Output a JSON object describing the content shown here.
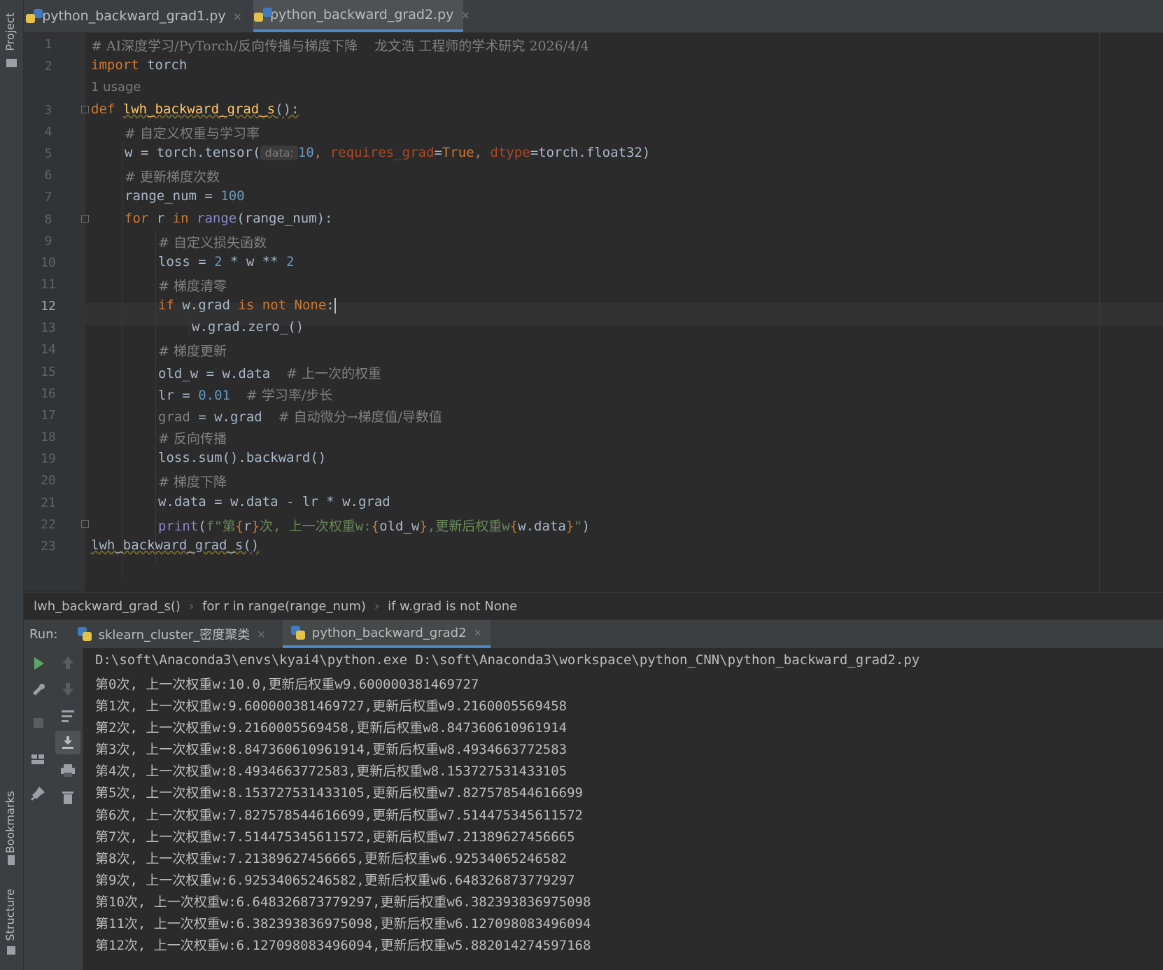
{
  "side_panel": {
    "project_label": "Project",
    "bookmarks_label": "Bookmarks",
    "structure_label": "Structure"
  },
  "tabs": [
    {
      "label": "python_backward_grad1.py",
      "close": "×"
    },
    {
      "label": "python_backward_grad2.py",
      "close": "×"
    }
  ],
  "editor": {
    "line_numbers": [
      "1",
      "2",
      "3",
      "4",
      "5",
      "6",
      "7",
      "8",
      "9",
      "10",
      "11",
      "12",
      "13",
      "14",
      "15",
      "16",
      "17",
      "18",
      "19",
      "20",
      "21",
      "22",
      "23"
    ],
    "current_line": "12",
    "usage_hint": "1 usage",
    "param_hint": "data:",
    "code": {
      "l1": "# AI深度学习/PyTorch/反向传播与梯度下降    龙文浩 工程师的学术研究 2026/4/4",
      "l2_kw": "import",
      "l2_rest": " torch",
      "l3_kw": "def",
      "l3_fn": "lwh_backward_grad_s",
      "l3_rest": "():",
      "l4": "# 自定义权重与学习率",
      "l5_a": "w = torch.tensor(",
      "l5_num": "10",
      "l5_comma1": ", ",
      "l5_p1": "requires_grad",
      "l5_eq1": "=",
      "l5_true": "True",
      "l5_comma2": ", ",
      "l5_p2": "dtype",
      "l5_tail": "=torch.float32)",
      "l6": "# 更新梯度次数",
      "l7_a": "range_num = ",
      "l7_num": "100",
      "l8_for": "for",
      "l8_b": " r ",
      "l8_in": "in",
      "l8_sp": " ",
      "l8_range": "range",
      "l8_tail": "(range_num):",
      "l9": "# 自定义损失函数",
      "l10_a": "loss = ",
      "l10_n1": "2",
      "l10_b": " * w ** ",
      "l10_n2": "2",
      "l11": "# 梯度清零",
      "l12_if": "if",
      "l12_b": " w.grad ",
      "l12_is": "is",
      "l12_sp": " ",
      "l12_not": "not",
      "l12_sp2": " ",
      "l12_none": "None",
      "l12_colon": ":",
      "l13": "w.grad.zero_()",
      "l14": "# 梯度更新",
      "l15_a": "old_w = w.data  ",
      "l15_c": "# 上一次的权重",
      "l16_a": "lr = ",
      "l16_num": "0.01",
      "l16_sp": "  ",
      "l16_c": "# 学习率/步长",
      "l17_a": "grad",
      "l17_b": " = w.grad  ",
      "l17_c": "# 自动微分→梯度值/导数值",
      "l18": "# 反向传播",
      "l19": "loss.sum().backward()",
      "l20": "# 梯度下降",
      "l21": "w.data = w.data - lr * w.grad",
      "l22_print": "print",
      "l22_a": "(",
      "l22_f": "f\"第",
      "l22_b1": "{",
      "l22_r": "r",
      "l22_b2": "}",
      "l22_s2": "次, 上一次权重w:",
      "l22_b3": "{",
      "l22_old": "old_w",
      "l22_b4": "}",
      "l22_s3": ",更新后权重w",
      "l22_b5": "{",
      "l22_wd": "w.data",
      "l22_b6": "}",
      "l22_end": "\"",
      "l22_close": ")",
      "l23": "lwh_backward_grad_s()"
    }
  },
  "breadcrumb": [
    "lwh_backward_grad_s()",
    "for r in range(range_num)",
    "if w.grad is not None"
  ],
  "breadcrumb_sep": "›",
  "run": {
    "label": "Run:",
    "tabs": [
      {
        "label": "sklearn_cluster_密度聚类",
        "close": "×"
      },
      {
        "label": "python_backward_grad2",
        "close": "×"
      }
    ],
    "output": [
      "D:\\soft\\Anaconda3\\envs\\kyai4\\python.exe D:\\soft\\Anaconda3\\workspace\\python_CNN\\python_backward_grad2.py",
      "第0次, 上一次权重w:10.0,更新后权重w9.600000381469727",
      "第1次, 上一次权重w:9.600000381469727,更新后权重w9.2160005569458",
      "第2次, 上一次权重w:9.2160005569458,更新后权重w8.847360610961914",
      "第3次, 上一次权重w:8.847360610961914,更新后权重w8.4934663772583",
      "第4次, 上一次权重w:8.4934663772583,更新后权重w8.153727531433105",
      "第5次, 上一次权重w:8.153727531433105,更新后权重w7.827578544616699",
      "第6次, 上一次权重w:7.827578544616699,更新后权重w7.514475345611572",
      "第7次, 上一次权重w:7.514475345611572,更新后权重w7.21389627456665",
      "第8次, 上一次权重w:7.21389627456665,更新后权重w6.92534065246582",
      "第9次, 上一次权重w:6.92534065246582,更新后权重w6.648326873779297",
      "第10次, 上一次权重w:6.648326873779297,更新后权重w6.382393836975098",
      "第11次, 上一次权重w:6.382393836975098,更新后权重w6.127098083496094",
      "第12次, 上一次权重w:6.127098083496094,更新后权重w5.882014274597168"
    ],
    "tool_icons": [
      "run-icon",
      "wrench-icon",
      "stop-icon",
      "layout-icon",
      "pin-icon",
      "up-arrow-icon",
      "down-arrow-icon",
      "soft-wrap-icon",
      "scroll-to-end-icon",
      "print-icon",
      "trash-icon"
    ]
  },
  "colors": {
    "background": "#2b2b2b",
    "keyword": "#cc7832",
    "number": "#6897bb",
    "function": "#ffc66d",
    "comment": "#808080",
    "string": "#6a8759",
    "accent": "#4a88c7"
  }
}
